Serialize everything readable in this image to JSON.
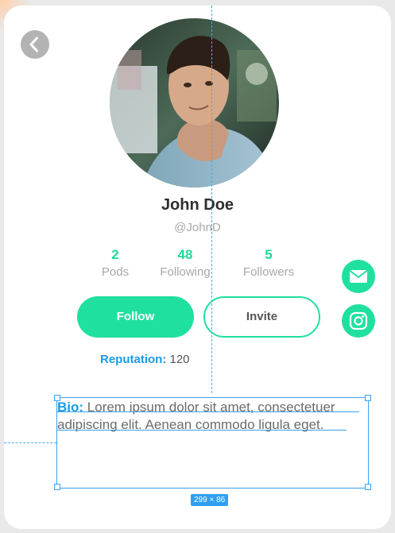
{
  "profile": {
    "name": "John Doe",
    "handle": "@JohnD"
  },
  "stats": [
    {
      "value": "2",
      "label": "Pods"
    },
    {
      "value": "48",
      "label": "Following"
    },
    {
      "value": "5",
      "label": "Followers"
    }
  ],
  "actions": {
    "follow_label": "Follow",
    "invite_label": "Invite"
  },
  "reputation": {
    "label": "Reputation:",
    "value": "120"
  },
  "bio": {
    "label": "Bio:",
    "text": "Lorem ipsum dolor sit amet, consectetuer adipiscing elit. Aenean commodo ligula eget."
  },
  "editor": {
    "selection_size": "299 × 86"
  },
  "icons": {
    "back": "chevron-left-icon",
    "mail": "envelope-icon",
    "instagram": "instagram-icon"
  },
  "colors": {
    "accent": "#1fe09f",
    "link": "#1a9be6",
    "guide": "#3aa0ee"
  }
}
